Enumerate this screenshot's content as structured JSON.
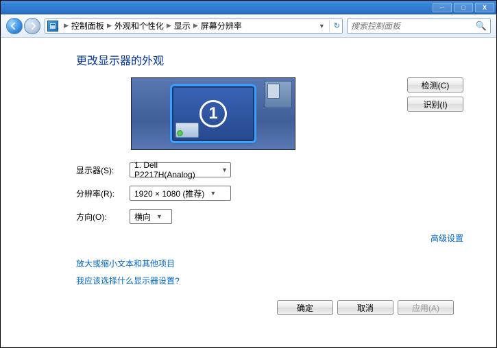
{
  "title_buttons": {
    "min": "─",
    "max": "□",
    "close": "X"
  },
  "breadcrumb": [
    "控制面板",
    "外观和个性化",
    "显示",
    "屏幕分辨率"
  ],
  "search": {
    "placeholder": "搜索控制面板"
  },
  "heading": "更改显示器的外观",
  "monitor": {
    "number": "1"
  },
  "buttons": {
    "detect": "检测(C)",
    "identify": "识别(I)"
  },
  "form": {
    "display_label": "显示器(S):",
    "display_value": "1. Dell P2217H(Analog)",
    "resolution_label": "分辨率(R):",
    "resolution_value": "1920 × 1080 (推荐)",
    "orientation_label": "方向(O):",
    "orientation_value": "横向"
  },
  "links": {
    "advanced": "高级设置",
    "text_size": "放大或缩小文本和其他项目",
    "help": "我应该选择什么显示器设置?"
  },
  "footer": {
    "ok": "确定",
    "cancel": "取消",
    "apply": "应用(A)"
  }
}
